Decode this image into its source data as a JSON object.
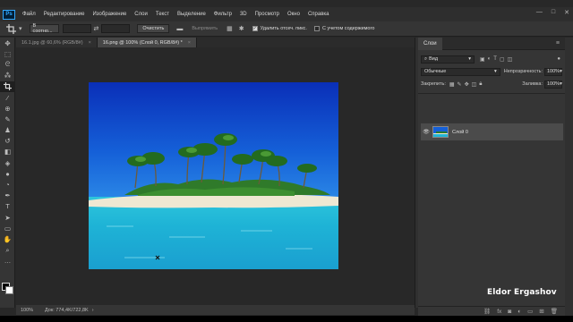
{
  "app": {
    "logo": "Ps",
    "menu": [
      "Файл",
      "Редактирование",
      "Изображение",
      "Слои",
      "Текст",
      "Выделение",
      "Фильтр",
      "3D",
      "Просмотр",
      "Окно",
      "Справка"
    ],
    "window_controls": [
      "—",
      "□",
      "✕"
    ]
  },
  "options": {
    "ratio_select": "В соотно...",
    "clear_button": "Очистить",
    "straighten_button": "Выпрямить",
    "delete_pixels_label": "Удалить отсеч. пикс.",
    "delete_pixels_checked": true,
    "content_aware_label": "С учетом содержимого",
    "content_aware_checked": false
  },
  "tabs": [
    {
      "label": "16.1.jpg @ 60,6% (RGB/8#)",
      "close": "×",
      "active": false
    },
    {
      "label": "16.png @ 100% (Слой 0, RGB/8#) *",
      "close": "×",
      "active": true
    }
  ],
  "status": {
    "zoom": "100%",
    "doc": "Док: 774,4K/722,8K"
  },
  "layers_panel": {
    "tab": "Слои",
    "filter_select": "Вид",
    "blend_mode": "Обычные",
    "opacity_label": "Непрозрачность:",
    "opacity_value": "100%",
    "lock_label": "Закрепить:",
    "fill_label": "Заливка:",
    "fill_value": "100%",
    "layers": [
      {
        "name": "Слой 0",
        "visible": true
      }
    ]
  },
  "watermark": "Eldor Ergashov",
  "colors": {
    "sky_top": "#0a3fc8",
    "sky_bottom": "#1d74e0",
    "sea": "#22b5d6",
    "sand": "#efe8d2",
    "palm_green": "#2f7a2a",
    "ps_blue": "#31a8ff"
  }
}
